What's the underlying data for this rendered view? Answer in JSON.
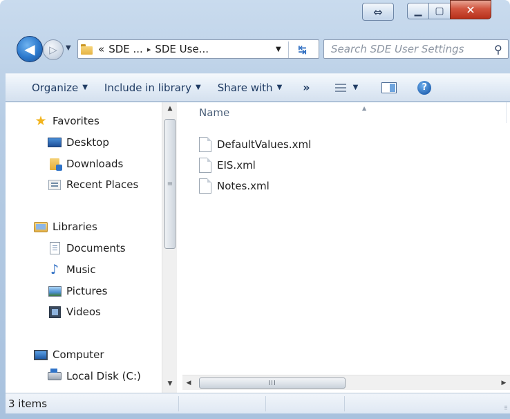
{
  "window": {
    "resize_glyph": "⇔",
    "minimize_glyph": "▁",
    "maximize_glyph": "▢",
    "close_glyph": "✕"
  },
  "address": {
    "back_glyph": "◀",
    "forward_glyph": "▷",
    "dropdown_glyph": "▼",
    "overflow_glyph": "«",
    "crumb_1": "SDE ...",
    "separator": "▸",
    "crumb_2": "SDE Use...",
    "refresh_glyph": "↹"
  },
  "search": {
    "placeholder": "Search SDE User Settings",
    "icon_glyph": "⚲"
  },
  "toolbar": {
    "organize": "Organize",
    "include_in_library": "Include in library",
    "share_with": "Share with",
    "more": "»",
    "caret": "▼",
    "help": "?"
  },
  "nav": {
    "favorites": "Favorites",
    "desktop": "Desktop",
    "downloads": "Downloads",
    "recent_places": "Recent Places",
    "libraries": "Libraries",
    "documents": "Documents",
    "music": "Music",
    "pictures": "Pictures",
    "videos": "Videos",
    "computer": "Computer",
    "local_disk": "Local Disk (C:)",
    "star_glyph": "★",
    "music_glyph": "♪"
  },
  "scrollbars": {
    "up": "▲",
    "down": "▼",
    "left": "◀",
    "right": "▶",
    "v_grip": "≡",
    "h_grip": "III"
  },
  "list": {
    "column_name": "Name",
    "sort_glyph": "▲",
    "files": [
      "DefaultValues.xml",
      "EIS.xml",
      "Notes.xml"
    ]
  },
  "status": {
    "items_text": "3 items",
    "grip": "⠿"
  },
  "colors": {
    "toolbar_text": "#1f3b63",
    "header_text": "#4c607a",
    "search_placeholder": "#8d96a3",
    "close_red": "#d1553f"
  }
}
